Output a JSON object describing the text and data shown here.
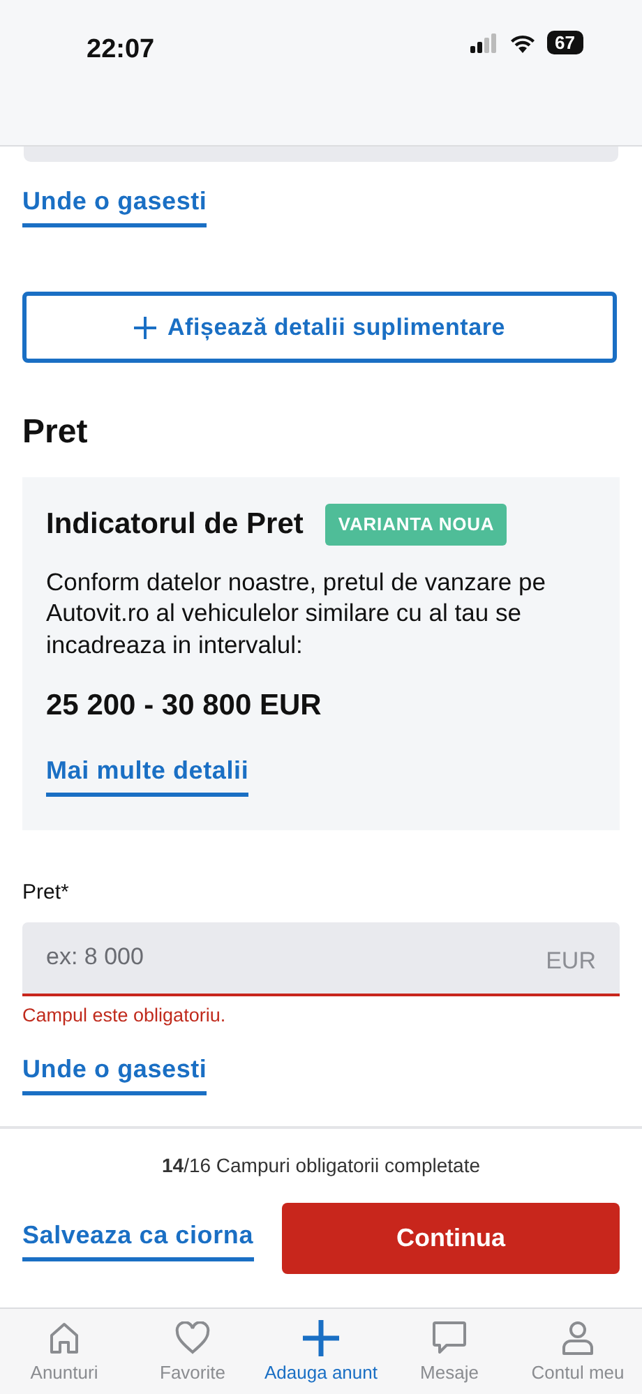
{
  "status_bar": {
    "time": "22:07",
    "battery": "67"
  },
  "form": {
    "top_link": "Unde o gasesti",
    "details_button": "Afișează detalii suplimentare",
    "section_title": "Pret",
    "price_card": {
      "title": "Indicatorul de Pret",
      "badge": "VARIANTA NOUA",
      "description": "Conform datelor noastre, pretul de vanzare pe Autovit.ro al vehiculelor similare cu al tau se incadreaza in intervalul:",
      "range": "25 200 - 30 800 EUR",
      "link": "Mai multe detalii"
    },
    "price_field": {
      "label": "Pret*",
      "placeholder": "ex: 8 000",
      "unit": "EUR",
      "error": "Campul este obligatoriu.",
      "invalid": true
    },
    "bottom_link": "Unde o gasesti"
  },
  "footer": {
    "progress": "**14**/16 Campuri obligatorii completate",
    "draft_link": "Salveaza ca ciorna",
    "continue_button": "Continua"
  },
  "tab_bar": [
    {
      "label": "Anunturi",
      "selected": false
    },
    {
      "label": "Favorite",
      "selected": false
    },
    {
      "label": "Adauga anunt",
      "selected": true
    },
    {
      "label": "Mesaje",
      "selected": false
    },
    {
      "label": "Contul meu",
      "selected": false
    }
  ]
}
